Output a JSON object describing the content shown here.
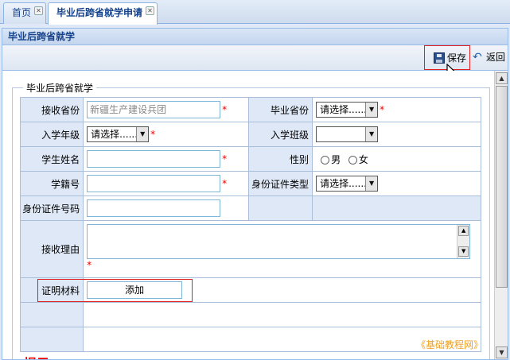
{
  "tabs": [
    {
      "label": "首页",
      "active": false
    },
    {
      "label": "毕业后跨省就学申请",
      "active": true
    }
  ],
  "panel": {
    "title": "毕业后跨省就学"
  },
  "toolbar": {
    "save_label": "保存",
    "back_label": "返回"
  },
  "form": {
    "legend": "毕业后跨省就学",
    "receive_province": {
      "label": "接收省份",
      "value": "新疆生产建设兵团"
    },
    "grad_province": {
      "label": "毕业省份",
      "value": "请选择......"
    },
    "enroll_grade": {
      "label": "入学年级",
      "value": "请选择......"
    },
    "enroll_class": {
      "label": "入学班级",
      "value": ""
    },
    "student_name": {
      "label": "学生姓名",
      "value": ""
    },
    "gender": {
      "label": "性别",
      "options": [
        "男",
        "女"
      ]
    },
    "student_id": {
      "label": "学籍号",
      "value": ""
    },
    "id_type": {
      "label": "身份证件类型",
      "value": "请选择......"
    },
    "id_number": {
      "label": "身份证件号码",
      "value": ""
    },
    "reason": {
      "label": "接收理由",
      "value": ""
    },
    "proof": {
      "label": "证明材料",
      "add_label": "添加"
    },
    "required_mark": "*"
  },
  "watermark": "《基础教程网》",
  "tip_partial": "提示",
  "colors": {
    "accent": "#15428b",
    "highlight": "#e02020",
    "required": "#e00000"
  }
}
